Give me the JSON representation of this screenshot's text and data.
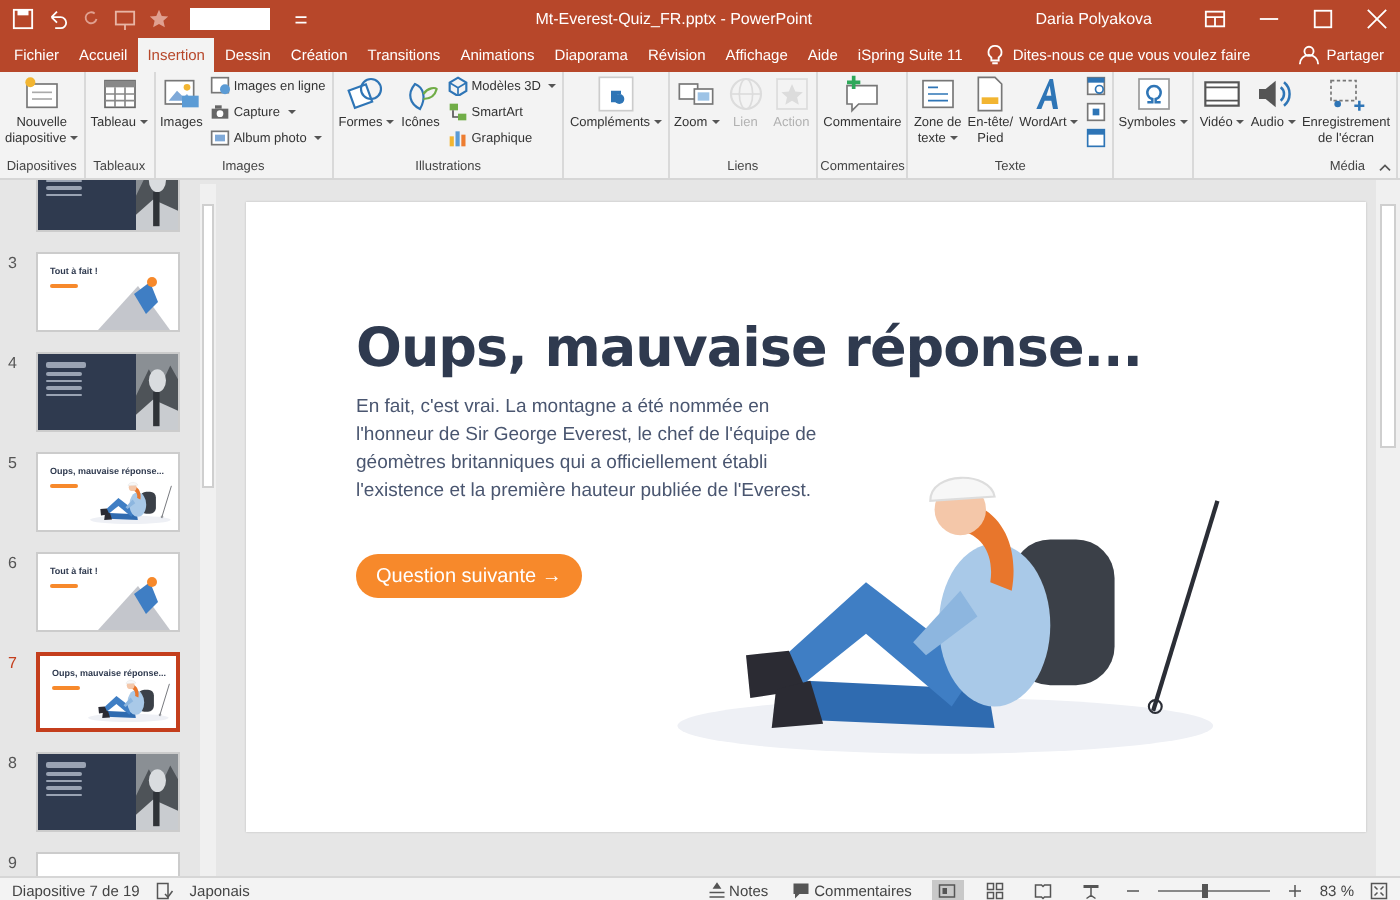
{
  "window": {
    "title": "Mt-Everest-Quiz_FR.pptx  -  PowerPoint",
    "user": "Daria Polyakova"
  },
  "tabs": [
    {
      "label": "Fichier",
      "selected": false
    },
    {
      "label": "Accueil",
      "selected": false
    },
    {
      "label": "Insertion",
      "selected": true
    },
    {
      "label": "Dessin",
      "selected": false
    },
    {
      "label": "Création",
      "selected": false
    },
    {
      "label": "Transitions",
      "selected": false
    },
    {
      "label": "Animations",
      "selected": false
    },
    {
      "label": "Diaporama",
      "selected": false
    },
    {
      "label": "Révision",
      "selected": false
    },
    {
      "label": "Affichage",
      "selected": false
    },
    {
      "label": "Aide",
      "selected": false
    },
    {
      "label": "iSpring Suite 11",
      "selected": false
    }
  ],
  "tell_me": "Dites-nous ce que vous voulez faire",
  "share": "Partager",
  "ribbon": {
    "groups": [
      {
        "name": "Diapositives",
        "items": [
          {
            "kind": "large",
            "label": "Nouvelle\ndiapositive",
            "dropdown": true,
            "disabled": false
          }
        ]
      },
      {
        "name": "Tableaux",
        "items": [
          {
            "kind": "large",
            "label": "Tableau",
            "dropdown": true,
            "disabled": false
          }
        ]
      },
      {
        "name": "Images",
        "items": [
          {
            "kind": "large",
            "label": "Images",
            "dropdown": false,
            "disabled": false
          },
          {
            "kind": "small",
            "label": "Images en ligne",
            "dropdown": false,
            "disabled": false
          },
          {
            "kind": "small",
            "label": "Capture",
            "dropdown": true,
            "disabled": false
          },
          {
            "kind": "small",
            "label": "Album photo",
            "dropdown": true,
            "disabled": false
          }
        ]
      },
      {
        "name": "Illustrations",
        "items": [
          {
            "kind": "large",
            "label": "Formes",
            "dropdown": true,
            "disabled": false
          },
          {
            "kind": "large",
            "label": "Icônes",
            "dropdown": false,
            "disabled": false
          },
          {
            "kind": "small",
            "label": "Modèles 3D",
            "dropdown": true,
            "disabled": false
          },
          {
            "kind": "small",
            "label": "SmartArt",
            "dropdown": false,
            "disabled": false
          },
          {
            "kind": "small",
            "label": "Graphique",
            "dropdown": false,
            "disabled": false
          }
        ]
      },
      {
        "items": [
          {
            "kind": "large",
            "label": "Compléments",
            "dropdown": true,
            "disabled": false
          }
        ]
      },
      {
        "name": "Liens",
        "items": [
          {
            "kind": "large",
            "label": "Zoom",
            "dropdown": true,
            "disabled": false
          },
          {
            "kind": "large",
            "label": "Lien",
            "dropdown": false,
            "disabled": true
          },
          {
            "kind": "large",
            "label": "Action",
            "dropdown": false,
            "disabled": true
          }
        ]
      },
      {
        "name": "Commentaires",
        "items": [
          {
            "kind": "large",
            "label": "Commentaire",
            "dropdown": false,
            "disabled": false
          }
        ]
      },
      {
        "name": "Texte",
        "items": [
          {
            "kind": "large",
            "label": "Zone de\ntexte",
            "dropdown": true,
            "disabled": false
          },
          {
            "kind": "large",
            "label": "En-tête/\nPied",
            "dropdown": false,
            "disabled": false
          },
          {
            "kind": "large",
            "label": "WordArt",
            "dropdown": true,
            "disabled": false
          },
          {
            "kind": "icon",
            "dropdown": false,
            "disabled": false
          },
          {
            "kind": "icon",
            "dropdown": false,
            "disabled": false
          },
          {
            "kind": "icon",
            "dropdown": false,
            "disabled": false
          }
        ]
      },
      {
        "items": [
          {
            "kind": "large",
            "label": "Symboles",
            "dropdown": true,
            "disabled": false
          }
        ]
      },
      {
        "name": "Média",
        "items": [
          {
            "kind": "large",
            "label": "Vidéo",
            "dropdown": true,
            "disabled": false
          },
          {
            "kind": "large",
            "label": "Audio",
            "dropdown": true,
            "disabled": false
          },
          {
            "kind": "large",
            "label": "Enregistrement\nde l'écran",
            "dropdown": false,
            "disabled": false
          }
        ]
      }
    ]
  },
  "slides": [
    {
      "kind": "dark",
      "selected": false
    },
    {
      "number": "3",
      "kind": "climber",
      "title": "Tout à fait !",
      "selected": false
    },
    {
      "number": "4",
      "kind": "dark",
      "selected": false
    },
    {
      "number": "5",
      "kind": "sitting",
      "title": "Oups, mauvaise réponse...",
      "selected": false
    },
    {
      "number": "6",
      "kind": "climber",
      "title": "Tout à fait !",
      "selected": false
    },
    {
      "number": "7",
      "kind": "sitting",
      "title": "Oups, mauvaise réponse...",
      "selected": true
    },
    {
      "number": "8",
      "kind": "dark",
      "selected": false
    },
    {
      "number": "9",
      "kind": "blank",
      "selected": false
    }
  ],
  "slide": {
    "title": "Oups, mauvaise réponse...",
    "body": "En fait, c'est vrai. La montagne a été nommée en l'honneur de Sir George Everest, le chef de l'équipe de géomètres britanniques qui a officiellement établi l'existence et la première hauteur publiée de l'Everest.",
    "button": "Question suivante →"
  },
  "status_bar": {
    "position": "Diapositive 7 de 19",
    "language": "Japonais",
    "notes": "Notes",
    "comments": "Commentaires",
    "views": [
      {
        "selected": true
      },
      {
        "selected": false
      },
      {
        "selected": false
      },
      {
        "selected": false
      }
    ],
    "zoom": {
      "level": 0.42
    },
    "zoom_text": "83 %"
  }
}
